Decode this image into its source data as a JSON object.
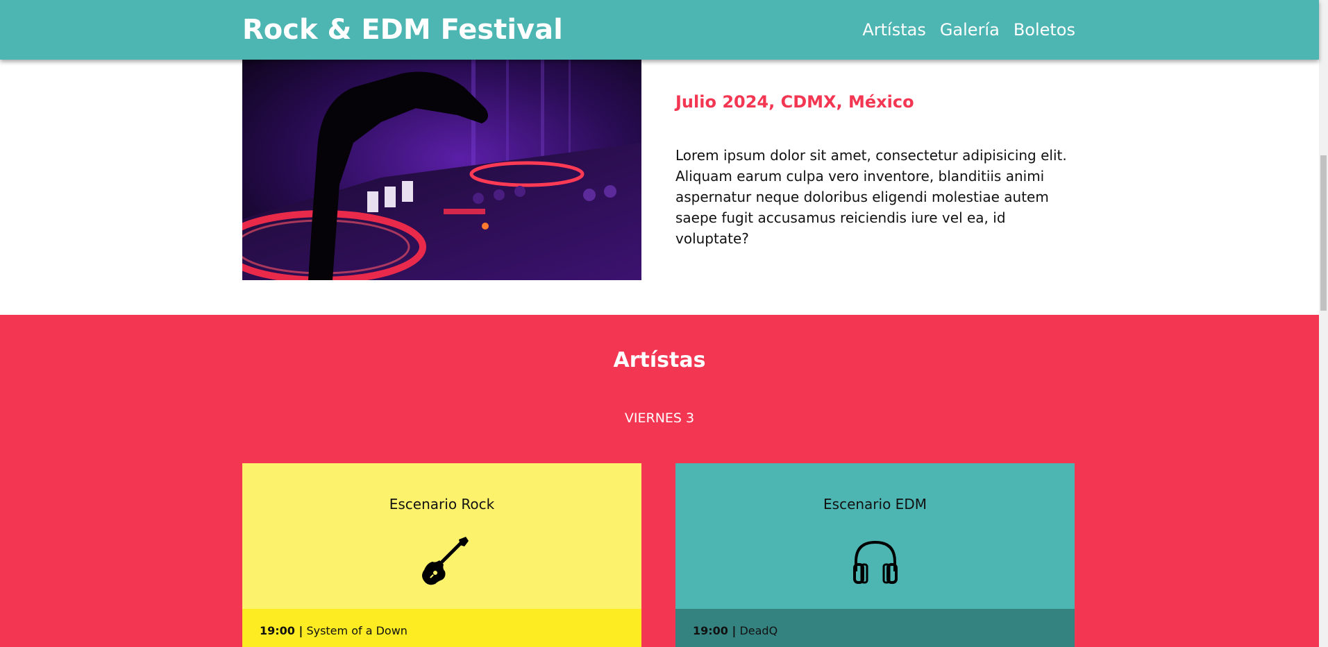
{
  "header": {
    "title": "Rock & EDM Festival",
    "nav": [
      "Artístas",
      "Galería",
      "Boletos"
    ],
    "color": "#4db6b3"
  },
  "about": {
    "date_location": "Julio 2024, CDMX, México",
    "description": "Lorem ipsum dolor sit amet, consectetur adipisicing elit. Aliquam earum culpa vero inventore, blanditiis animi aspernatur neque doloribus eligendi molestiae autem saepe fugit accusamus reiciendis iure vel ea, id voluptate?",
    "accent_color": "#f33652"
  },
  "artists": {
    "title": "Artístas",
    "day": "VIERNES 3",
    "background_color": "#f33652",
    "stages": [
      {
        "name": "Escenario Rock",
        "icon": "guitar-icon",
        "color": "#fdf26c",
        "row_color": "#fdec21",
        "rows": [
          {
            "time": "19:00 |",
            "artist": "System of a Down"
          }
        ]
      },
      {
        "name": "Escenario EDM",
        "icon": "headphones-icon",
        "color": "#4db6b3",
        "row_color": "#348380",
        "rows": [
          {
            "time": "19:00 |",
            "artist": "DeadQ"
          }
        ]
      }
    ]
  }
}
